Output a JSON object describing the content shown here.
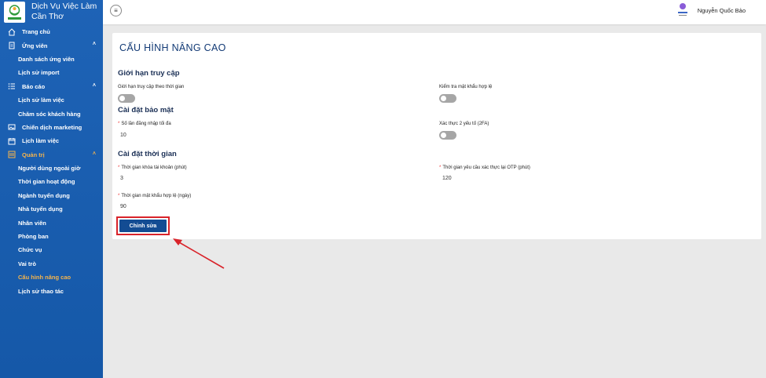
{
  "brand": {
    "line1": "Dịch Vụ Việc Làm",
    "line2": "Cần Thơ"
  },
  "sidebar": {
    "items": [
      {
        "label": "Trang chủ",
        "type": "parent",
        "icon": "home-icon"
      },
      {
        "label": "Ứng viên",
        "type": "parent",
        "icon": "document-icon",
        "expanded": true
      },
      {
        "label": "Danh sách ứng viên",
        "type": "child"
      },
      {
        "label": "Lịch sử import",
        "type": "child"
      },
      {
        "label": "Báo cáo",
        "type": "parent",
        "icon": "list-icon",
        "expanded": true
      },
      {
        "label": "Lịch sử làm việc",
        "type": "child"
      },
      {
        "label": "Chăm sóc khách hàng",
        "type": "child"
      },
      {
        "label": "Chiến dịch marketing",
        "type": "parent",
        "icon": "image-icon"
      },
      {
        "label": "Lịch làm việc",
        "type": "parent",
        "icon": "calendar-icon"
      },
      {
        "label": "Quản trị",
        "type": "parent",
        "icon": "settings-icon",
        "expanded": true,
        "active": true
      },
      {
        "label": "Người dùng ngoài giờ",
        "type": "child"
      },
      {
        "label": "Thời gian hoạt động",
        "type": "child"
      },
      {
        "label": "Ngành tuyển dụng",
        "type": "child"
      },
      {
        "label": "Nhà tuyển dụng",
        "type": "child"
      },
      {
        "label": "Nhân viên",
        "type": "child"
      },
      {
        "label": "Phòng ban",
        "type": "child"
      },
      {
        "label": "Chức vụ",
        "type": "child"
      },
      {
        "label": "Vai trò",
        "type": "child"
      },
      {
        "label": "Cấu hình nâng cao",
        "type": "child",
        "active": true
      },
      {
        "label": "Lịch sử thao tác",
        "type": "child"
      }
    ]
  },
  "header": {
    "menu_icon": "≡",
    "username": "Nguyễn Quốc Bảo"
  },
  "main": {
    "title": "CẤU HÌNH NÂNG CAO",
    "access_limit": {
      "heading": "Giới hạn truy cập",
      "time_limit_label": "Giới hạn truy cập theo thời gian",
      "time_limit_on": false,
      "password_check_label": "Kiểm tra mật khẩu hợp lệ",
      "password_check_on": false
    },
    "security": {
      "heading": "Cài đặt bảo mật",
      "max_login_label": "Số lần đăng nhập tối đa",
      "max_login_value": "10",
      "twofa_label": "Xác thực 2 yếu tố (2FA)",
      "twofa_on": false
    },
    "time_settings": {
      "heading": "Cài đặt thời gian",
      "lock_label": "Thời gian khóa tài khoản (phút)",
      "lock_value": "3",
      "otp_label": "Thời gian yêu cầu xác thực lại OTP (phút)",
      "otp_value": "120",
      "pwd_valid_label": "Thời gian mật khẩu hợp lệ (ngày)",
      "pwd_valid_value": "90"
    },
    "edit_button": "Chỉnh sửa"
  },
  "colors": {
    "sidebar": "#1e63b6",
    "active": "#f6b44c",
    "button": "#134c93",
    "highlight": "#d9232a"
  }
}
